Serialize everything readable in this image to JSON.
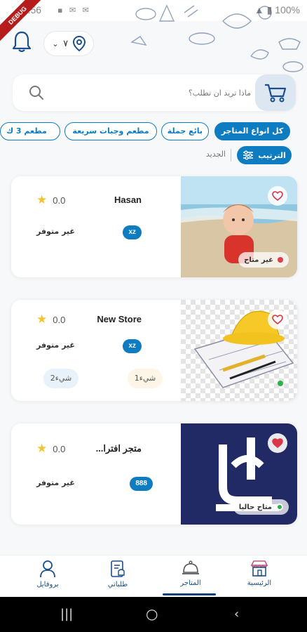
{
  "status_bar": {
    "time": "16:56",
    "battery": "100%"
  },
  "debug_banner": "DEBUG",
  "header": {
    "location_label": "٧"
  },
  "search": {
    "placeholder": "ماذا تريد ان تطلب؟"
  },
  "chips": [
    {
      "label": "كل انواع المتاجر",
      "active": true
    },
    {
      "label": "بائع جملة",
      "active": false
    },
    {
      "label": "مطعم وجبات سريعة",
      "active": false
    },
    {
      "label": "مطعم 3 ك",
      "active": false
    }
  ],
  "sort": {
    "button_label": "الترتيب",
    "new_label": "الجديد"
  },
  "stores": [
    {
      "name": "Hasan",
      "rating": "0.0",
      "status": "غير متوفر",
      "tag": "xz",
      "availability": "غير متاح",
      "favorite": false,
      "sub_tags": []
    },
    {
      "name": "New Store",
      "rating": "0.0",
      "status": "غير متوفر",
      "tag": "xz",
      "availability": "",
      "favorite": false,
      "sub_tags": [
        "شيء1",
        "شيء2"
      ]
    },
    {
      "name": "متجر افترا...",
      "rating": "0.0",
      "status": "غير متوفر",
      "tag": "888",
      "availability": "متاح حاليا",
      "favorite": true,
      "sub_tags": []
    }
  ],
  "bottom_nav": [
    {
      "label": "الرئيسية",
      "icon": "store-icon"
    },
    {
      "label": "المتاجر",
      "icon": "cloche-icon",
      "active": true
    },
    {
      "label": "طلباتي",
      "icon": "orders-icon"
    },
    {
      "label": "بروفايل",
      "icon": "person-icon"
    }
  ],
  "colors": {
    "primary": "#0e7cc1",
    "card_bg": "#ffffff",
    "page_bg": "#f7f8fa",
    "nav_text": "#1a4f8b"
  }
}
